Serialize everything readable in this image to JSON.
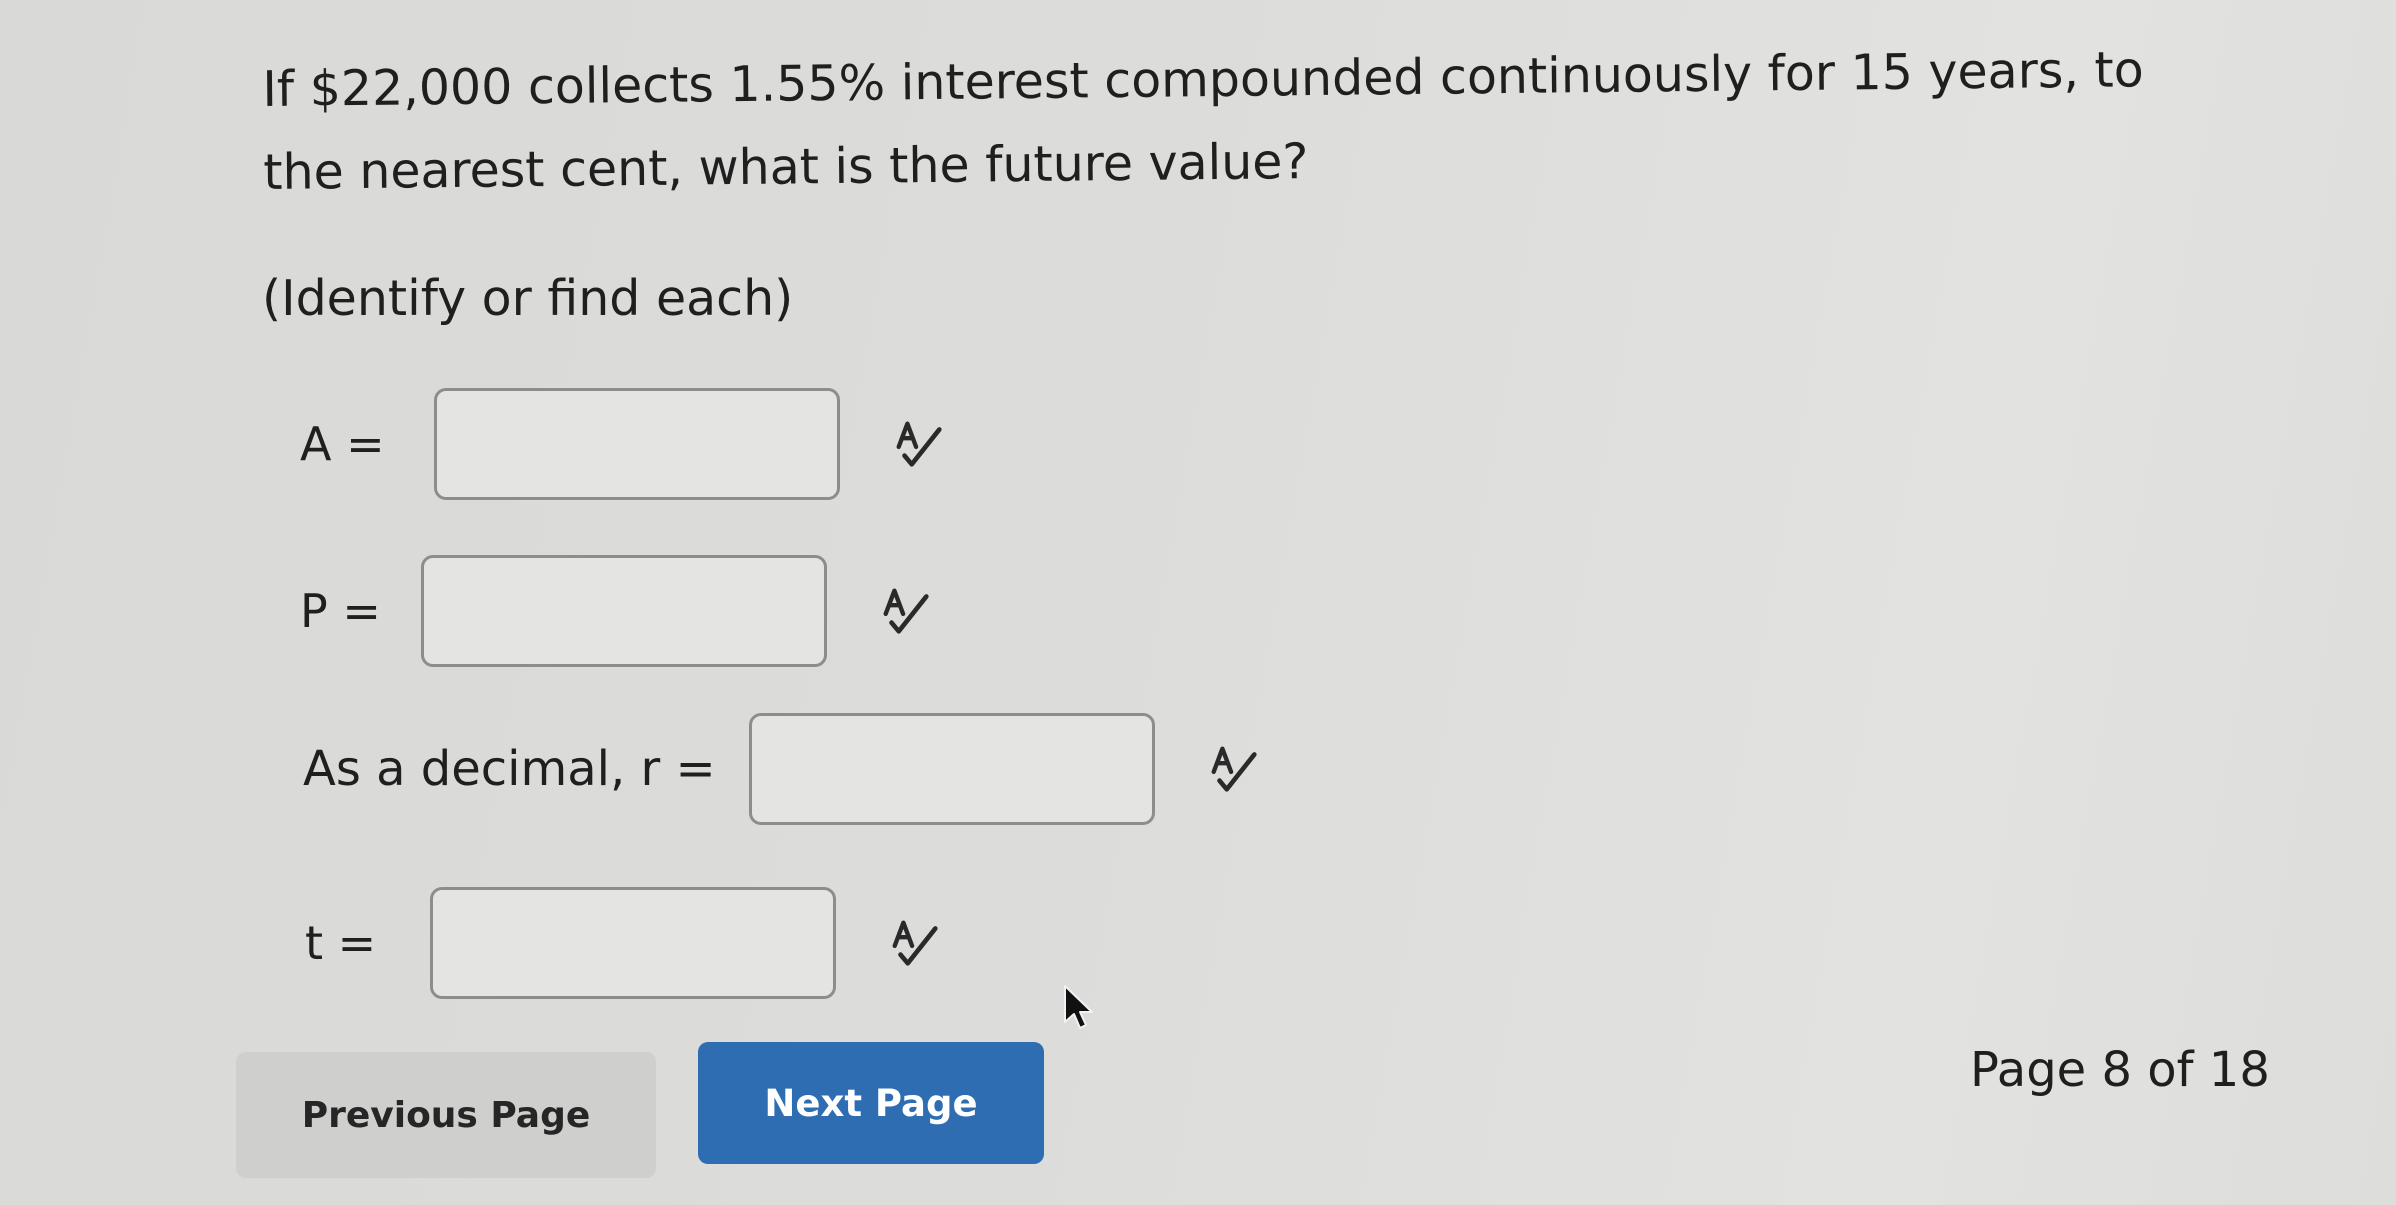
{
  "question": {
    "text": "If $22,000 collects 1.55% interest compounded continuously for 15 years, to the nearest cent, what is the future value?",
    "instruction": "(Identify or find each)"
  },
  "fields": [
    {
      "label": "A =",
      "value": "",
      "icon": "spellcheck-icon"
    },
    {
      "label": "P =",
      "value": "",
      "icon": "spellcheck-icon"
    },
    {
      "label": "As a decimal, r =",
      "value": "",
      "icon": "spellcheck-icon"
    },
    {
      "label": "t =",
      "value": "",
      "icon": "spellcheck-icon"
    }
  ],
  "navigation": {
    "previous_label": "Previous Page",
    "next_label": "Next Page",
    "page_indicator": "Page 8 of 18"
  },
  "colors": {
    "next_button": "#2f6db3",
    "previous_button": "#cfcfcd",
    "input_border": "#8d8d8d",
    "text": "#1f1f1f"
  },
  "icons": {
    "spellcheck": "spellcheck-icon",
    "cursor": "mouse-pointer-icon"
  }
}
